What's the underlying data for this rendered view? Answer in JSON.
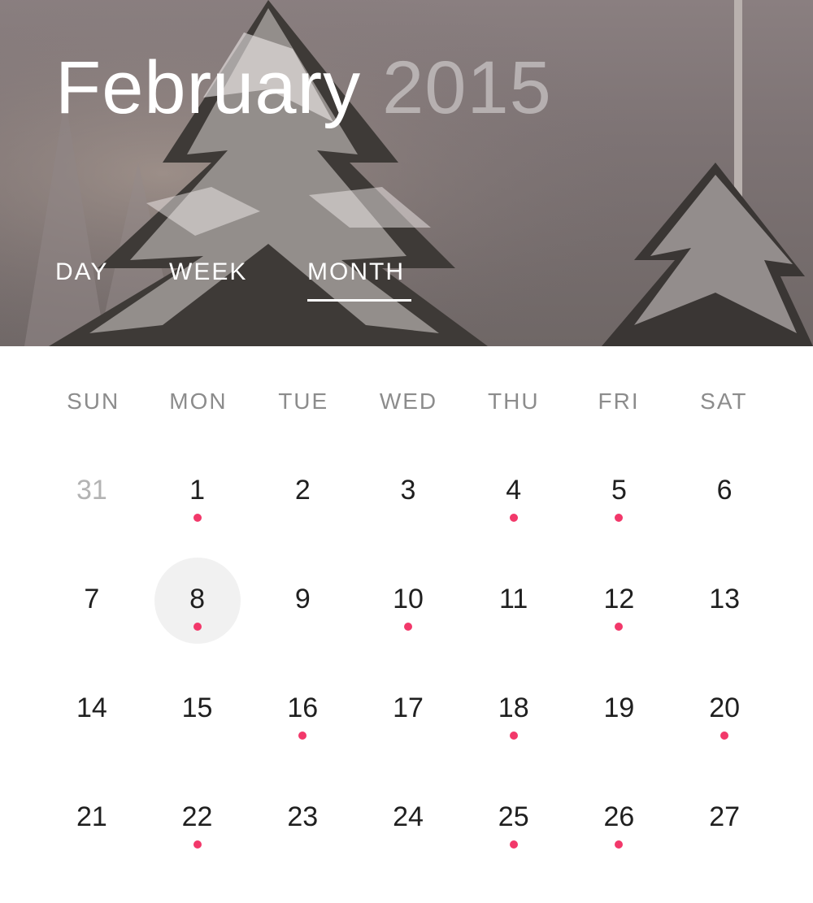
{
  "header": {
    "month": "February",
    "year": "2015"
  },
  "view_tabs": {
    "day": "DAY",
    "week": "WEEK",
    "month": "MONTH",
    "active": "month"
  },
  "weekdays": [
    "SUN",
    "MON",
    "TUE",
    "WED",
    "THU",
    "FRI",
    "SAT"
  ],
  "colors": {
    "event_dot": "#f2386a",
    "selected_bg": "#f1f1f1",
    "other_month_text": "#b3b3b3"
  },
  "icons": {
    "event": "event-dot-icon"
  },
  "days": [
    {
      "label": "31",
      "current_month": false,
      "event": false,
      "selected": false
    },
    {
      "label": "1",
      "current_month": true,
      "event": true,
      "selected": false
    },
    {
      "label": "2",
      "current_month": true,
      "event": false,
      "selected": false
    },
    {
      "label": "3",
      "current_month": true,
      "event": false,
      "selected": false
    },
    {
      "label": "4",
      "current_month": true,
      "event": true,
      "selected": false
    },
    {
      "label": "5",
      "current_month": true,
      "event": true,
      "selected": false
    },
    {
      "label": "6",
      "current_month": true,
      "event": false,
      "selected": false
    },
    {
      "label": "7",
      "current_month": true,
      "event": false,
      "selected": false
    },
    {
      "label": "8",
      "current_month": true,
      "event": true,
      "selected": true
    },
    {
      "label": "9",
      "current_month": true,
      "event": false,
      "selected": false
    },
    {
      "label": "10",
      "current_month": true,
      "event": true,
      "selected": false
    },
    {
      "label": "11",
      "current_month": true,
      "event": false,
      "selected": false
    },
    {
      "label": "12",
      "current_month": true,
      "event": true,
      "selected": false
    },
    {
      "label": "13",
      "current_month": true,
      "event": false,
      "selected": false
    },
    {
      "label": "14",
      "current_month": true,
      "event": false,
      "selected": false
    },
    {
      "label": "15",
      "current_month": true,
      "event": false,
      "selected": false
    },
    {
      "label": "16",
      "current_month": true,
      "event": true,
      "selected": false
    },
    {
      "label": "17",
      "current_month": true,
      "event": false,
      "selected": false
    },
    {
      "label": "18",
      "current_month": true,
      "event": true,
      "selected": false
    },
    {
      "label": "19",
      "current_month": true,
      "event": false,
      "selected": false
    },
    {
      "label": "20",
      "current_month": true,
      "event": true,
      "selected": false
    },
    {
      "label": "21",
      "current_month": true,
      "event": false,
      "selected": false
    },
    {
      "label": "22",
      "current_month": true,
      "event": true,
      "selected": false
    },
    {
      "label": "23",
      "current_month": true,
      "event": false,
      "selected": false
    },
    {
      "label": "24",
      "current_month": true,
      "event": false,
      "selected": false
    },
    {
      "label": "25",
      "current_month": true,
      "event": true,
      "selected": false
    },
    {
      "label": "26",
      "current_month": true,
      "event": true,
      "selected": false
    },
    {
      "label": "27",
      "current_month": true,
      "event": false,
      "selected": false
    }
  ]
}
